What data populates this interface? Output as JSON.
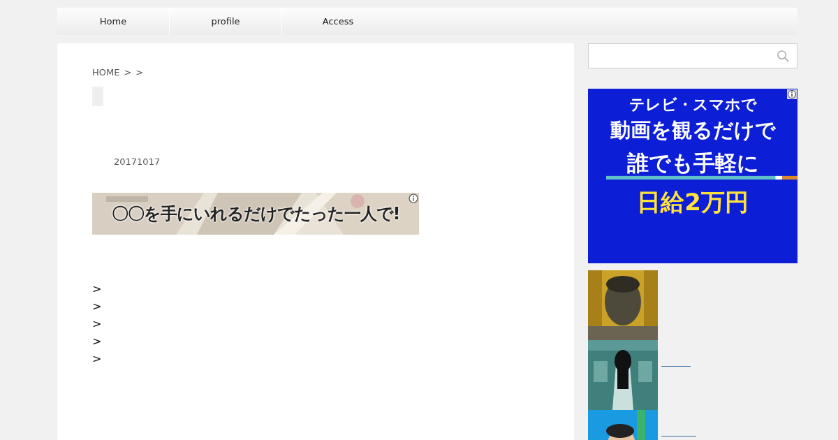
{
  "nav": [
    {
      "label": "Home"
    },
    {
      "label": "profile"
    },
    {
      "label": "Access"
    }
  ],
  "breadcrumb": [
    "HOME",
    ">",
    ">"
  ],
  "date": "20171017",
  "banner_ad": {
    "text": "〇〇を手にいれるだけでたった一人で!"
  },
  "list_markers": [
    ">",
    ">",
    ">",
    ">",
    ">"
  ],
  "side_ad": {
    "lines": [
      "テレビ・スマホで",
      "動画を観るだけで",
      "誰でも手軽に",
      "日給2万円"
    ]
  },
  "related": [
    {
      "kind": "picture",
      "link": false
    },
    {
      "kind": "picture",
      "link": true
    },
    {
      "kind": "picture",
      "link": true
    }
  ]
}
